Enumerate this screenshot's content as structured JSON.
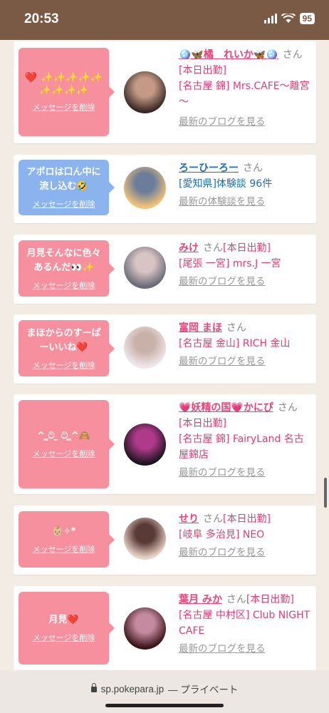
{
  "status": {
    "time": "20:53",
    "battery": "95"
  },
  "cards": [
    {
      "msg": "❤️ ✨✨✨✨✨ ✨✨✨✨",
      "delete": "メッセージを削除",
      "name": "🪩🦋橘　れいか🦋🪩",
      "san": "さん",
      "line1": "[本日出勤]",
      "line2": "[名古屋 錦] Mrs.CAFE～離宮～",
      "blog": "最新のブログを見る",
      "avatar": [
        "#3a2a24",
        "#c49a86"
      ]
    },
    {
      "msg": "アポロは口ん中に流し込む🤣",
      "delete": "メッセージを削除",
      "name": "ろーひーろー",
      "san": "さん",
      "line1": "",
      "line2": "[愛知県]体験談 96件",
      "blog": "最新の体験談を見る",
      "avatar": [
        "#f2c27a",
        "#6b7d9a"
      ]
    },
    {
      "msg": "月見そんなに色々あるんだ👀✨",
      "delete": "メッセージを削除",
      "name": "みけ",
      "san": "さん",
      "line1": "[本日出勤]",
      "line2": "[尾張 一宮] mrs.J 一宮",
      "blog": "最新のブログを見る",
      "avatar": [
        "#6a6a78",
        "#d8c4c4"
      ]
    },
    {
      "msg": "まほからのすーぱーいいね❤️",
      "delete": "メッセージを削除",
      "name": "富岡 まほ",
      "san": "さん",
      "line1": "",
      "line2": "[名古屋 金山] RICH 金山",
      "blog": "最新のブログを見る",
      "avatar": [
        "#efe6ea",
        "#c9b0a8"
      ]
    },
    {
      "msg": "^ ̳ට ̫ ට ̳^🙈",
      "delete": "メッセージを削除",
      "name": "💗妖精の国💗かにぴ",
      "san": "さん",
      "line1": "[本日出勤]",
      "line2": "[名古屋 錦] FairyLand 名古屋錦店",
      "blog": "最新のブログを見る",
      "avatar": [
        "#1c1420",
        "#b03a8a"
      ]
    },
    {
      "msg": "👶🏼✧*",
      "delete": "メッセージを削除",
      "name": "せり",
      "san": "さん",
      "line1": "[本日出勤]",
      "line2": "[岐阜 多治見] NEO",
      "blog": "最新のブログを見る",
      "avatar": [
        "#e9d3c9",
        "#5a3a36"
      ]
    },
    {
      "msg": "月見❤️",
      "delete": "メッセージを削除",
      "name": "葉月 みか",
      "san": "さん",
      "line1": "[本日出勤]",
      "line2": "[名古屋 中村区] Club NIGHT CAFE",
      "blog": "最新のブログを見る",
      "avatar": [
        "#3a1418",
        "#c58aa0"
      ]
    }
  ],
  "urlbar": {
    "url": "sp.pokepara.jp",
    "mode": "— プライベート"
  }
}
